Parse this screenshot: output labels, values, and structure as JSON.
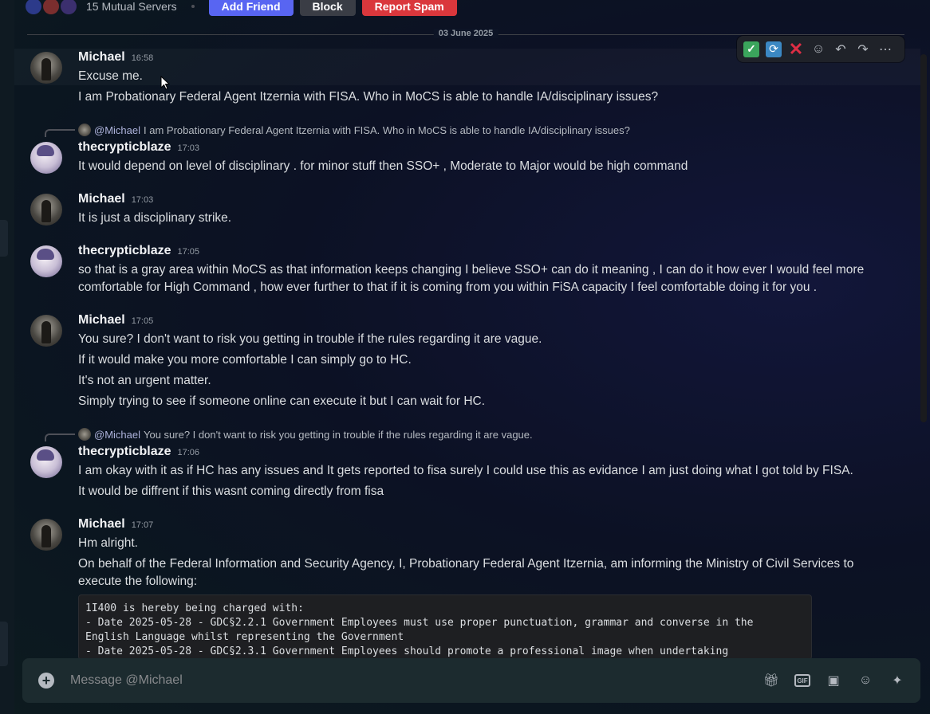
{
  "header": {
    "mutual_servers": "15 Mutual Servers",
    "add_friend": "Add Friend",
    "block": "Block",
    "report_spam": "Report Spam"
  },
  "date_divider": "03 June 2025",
  "messages": [
    {
      "author": "Michael",
      "time": "16:58",
      "lines": [
        "Excuse me.",
        "I am Probationary Federal Agent Itzernia with FISA. Who in MoCS is able to handle IA/disciplinary issues?"
      ]
    },
    {
      "reply_mention": "@Michael",
      "reply_text": "I am Probationary Federal Agent Itzernia with FISA. Who in MoCS is able to handle IA/disciplinary issues?",
      "author": "thecrypticblaze",
      "time": "17:03",
      "lines": [
        "It would depend on level of disciplinary . for minor stuff then SSO+ , Moderate to Major would be high command"
      ]
    },
    {
      "author": "Michael",
      "time": "17:03",
      "lines": [
        "It is just a disciplinary strike."
      ]
    },
    {
      "author": "thecrypticblaze",
      "time": "17:05",
      "lines": [
        "so that is a gray area within MoCS as that information keeps changing I believe SSO+ can do it meaning , I can do it how ever I would feel more",
        "comfortable for High Command , how ever further to that if it is coming from you within FiSA capacity I feel comfortable doing it for you ."
      ]
    },
    {
      "author": "Michael",
      "time": "17:05",
      "lines": [
        "You sure? I don't want to risk you getting in trouble if the rules regarding it are vague.",
        "If it would make you more comfortable I can simply go to HC.",
        "It's not an urgent matter.",
        "Simply trying to see if someone online can execute it but I can wait for HC."
      ]
    },
    {
      "reply_mention": "@Michael",
      "reply_text": "You sure? I don't want to risk you getting in trouble if the rules regarding it are vague.",
      "author": "thecrypticblaze",
      "time": "17:06",
      "lines": [
        "I am okay with it as if HC has any issues and It gets reported to fisa surely I could use this as evidance I am just doing what I got told by FISA.",
        "It would be diffrent if this wasnt coming directly from fisa"
      ]
    },
    {
      "author": "Michael",
      "time": "17:07",
      "lines": [
        "Hm alright.",
        "On behalf of the Federal Information and Security Agency, I, Probationary Federal Agent Itzernia, am informing the Ministry of Civil Services to",
        "execute the following:"
      ]
    }
  ],
  "code_block": "1I400 is hereby being charged with:\n- Date 2025-05-28 - GDC§2.2.1 Government Employees must use proper punctuation, grammar and converse in the\nEnglish Language whilst representing the Government\n- Date 2025-05-28 - GDC§2.3.1 Government Employees should promote a professional image when undertaking",
  "composer": {
    "placeholder": "Message @Michael"
  },
  "toolbar_icons": [
    "check-emoji",
    "repeat-emoji",
    "cross-emoji",
    "add-reaction",
    "reply",
    "forward",
    "more"
  ],
  "colors": {
    "blurple": "#5865f2",
    "danger": "#da373c",
    "neutral": "#3a3d45"
  }
}
